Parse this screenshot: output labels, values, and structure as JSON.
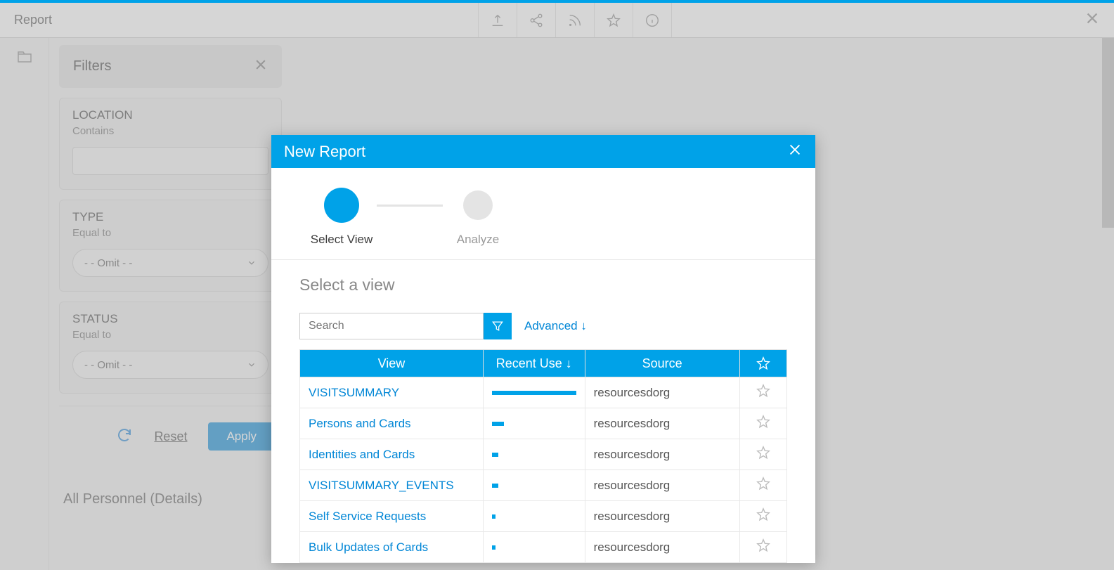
{
  "topbar": {
    "title": "Report"
  },
  "filters": {
    "title": "Filters",
    "location": {
      "label": "LOCATION",
      "sub": "Contains",
      "value": ""
    },
    "type": {
      "label": "TYPE",
      "sub": "Equal to",
      "value": "- - Omit - -"
    },
    "status": {
      "label": "STATUS",
      "sub": "Equal to",
      "value": "- - Omit - -"
    },
    "reset": "Reset",
    "apply": "Apply"
  },
  "report_name": "All Personnel (Details)",
  "modal": {
    "title": "New Report",
    "steps": [
      {
        "label": "Select View",
        "active": true
      },
      {
        "label": "Analyze",
        "active": false
      }
    ],
    "section_title": "Select a view",
    "search_placeholder": "Search",
    "advanced": "Advanced ↓",
    "columns": {
      "view": "View",
      "recent": "Recent Use ↓",
      "source": "Source"
    },
    "rows": [
      {
        "view": "VISITSUMMARY",
        "usage": 100,
        "source": "resourcesdorg"
      },
      {
        "view": "Persons and Cards",
        "usage": 14,
        "source": "resourcesdorg"
      },
      {
        "view": "Identities and Cards",
        "usage": 8,
        "source": "resourcesdorg"
      },
      {
        "view": "VISITSUMMARY_EVENTS",
        "usage": 8,
        "source": "resourcesdorg"
      },
      {
        "view": "Self Service Requests",
        "usage": 4,
        "source": "resourcesdorg"
      },
      {
        "view": "Bulk Updates of Cards",
        "usage": 4,
        "source": "resourcesdorg"
      }
    ]
  }
}
